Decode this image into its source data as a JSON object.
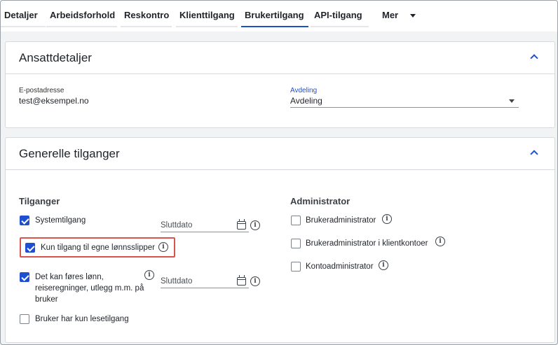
{
  "tabs": [
    {
      "label": "Detaljer",
      "active": false
    },
    {
      "label": "Arbeidsforhold",
      "active": false
    },
    {
      "label": "Reskontro",
      "active": false
    },
    {
      "label": "Klienttilgang",
      "active": false
    },
    {
      "label": "Brukertilgang",
      "active": true
    },
    {
      "label": "API-tilgang",
      "active": false
    }
  ],
  "more_tab": {
    "label": "Mer",
    "icon": "chevron-down-icon"
  },
  "employee_card": {
    "title": "Ansattdetaljer",
    "email_label": "E-postadresse",
    "email_value": "test@eksempel.no",
    "department_label": "Avdeling",
    "department_value": "Avdeling"
  },
  "access_card": {
    "title": "Generelle tilganger",
    "access_heading": "Tilganger",
    "admin_heading": "Administrator",
    "access_items": [
      {
        "label": "Systemtilgang",
        "checked": true
      },
      {
        "label": "Kun tilgang til egne lønnsslipper",
        "checked": true
      },
      {
        "label": "Det kan føres lønn, reiseregninger, utlegg m.m. på bruker",
        "checked": true
      },
      {
        "label": "Bruker har kun lesetilgang",
        "checked": false
      }
    ],
    "end_date_placeholder": "Sluttdato",
    "admin_items": [
      {
        "label": "Brukeradministrator",
        "checked": false
      },
      {
        "label": "Brukeradministrator i klientkontoer",
        "checked": false
      },
      {
        "label": "Kontoadministrator",
        "checked": false
      }
    ]
  },
  "colors": {
    "accent": "#1f4fd1",
    "highlight": "#d9534f"
  }
}
